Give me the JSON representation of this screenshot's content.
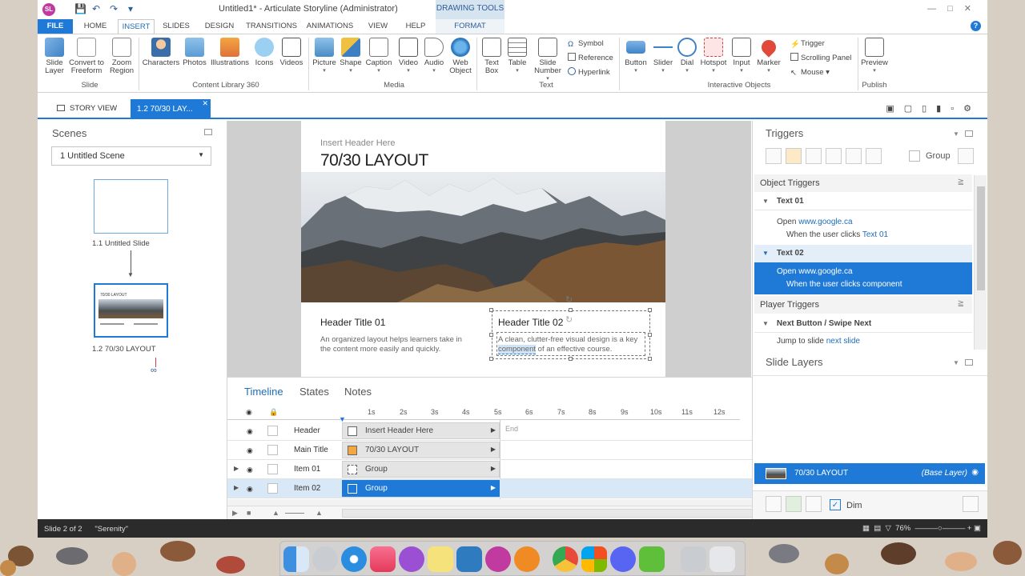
{
  "titlebar": {
    "logo": "SL",
    "title": "Untitled1* -  Articulate Storyline (Administrator)",
    "context_tab": "DRAWING TOOLS"
  },
  "tabs": [
    "FILE",
    "HOME",
    "INSERT",
    "SLIDES",
    "DESIGN",
    "TRANSITIONS",
    "ANIMATIONS",
    "VIEW",
    "HELP",
    "FORMAT"
  ],
  "ribbon": {
    "slide_group": [
      "Slide Layer",
      "Convert to Freeform",
      "Zoom Region"
    ],
    "slide_group_label": "Slide",
    "content_library": [
      "Characters",
      "Photos",
      "Illustrations",
      "Icons",
      "Videos"
    ],
    "content_library_label": "Content Library 360",
    "media": [
      "Picture",
      "Shape",
      "Caption",
      "Video",
      "Audio",
      "Web Object"
    ],
    "media_label": "Media",
    "text": [
      "Text Box",
      "Table",
      "Slide Number"
    ],
    "text_small": [
      "Symbol",
      "Reference",
      "Hyperlink"
    ],
    "text_label": "Text",
    "interactive": [
      "Button",
      "Slider",
      "Dial",
      "Hotspot",
      "Input",
      "Marker"
    ],
    "interactive_small": [
      "Trigger",
      "Scrolling Panel",
      "Mouse"
    ],
    "interactive_label": "Interactive Objects",
    "publish": "Preview",
    "publish_label": "Publish"
  },
  "docbar": {
    "story_view": "STORY VIEW",
    "slide_tab": "1.2 70/30 LAY..."
  },
  "scenes": {
    "title": "Scenes",
    "selected_scene": "1 Untitled Scene",
    "slides": [
      "1.1 Untitled Slide",
      "1.2 70/30 LAYOUT"
    ]
  },
  "slide": {
    "insert_header": "Insert Header Here",
    "main_title": "70/30 LAYOUT",
    "header_title_01": "Header Title 01",
    "text_01": "An organized layout helps learners take in the content more easily and quickly.",
    "header_title_02": "Header Title 02",
    "text_02_before": "A clean, clutter-free visual design is a key ",
    "text_02_highlight": "component",
    "text_02_after": " of an effective course."
  },
  "timeline": {
    "tabs": [
      "Timeline",
      "States",
      "Notes"
    ],
    "ticks": [
      "1s",
      "2s",
      "3s",
      "4s",
      "5s",
      "6s",
      "7s",
      "8s",
      "9s",
      "10s",
      "11s",
      "12s"
    ],
    "rows": [
      {
        "name": "Header",
        "bar": "Insert Header Here"
      },
      {
        "name": "Main Title",
        "bar": "70/30 LAYOUT"
      },
      {
        "name": "Item 01",
        "bar": "Group"
      },
      {
        "name": "Item 02",
        "bar": "Group"
      }
    ],
    "end_label": "End"
  },
  "triggers": {
    "title": "Triggers",
    "group_label": "Group",
    "object_triggers": "Object Triggers",
    "text01_head": "Text 01",
    "text01_action": "Open",
    "text01_url": "www.google.ca",
    "text01_when": "When the user clicks",
    "text01_obj": "Text 01",
    "text02_head": "Text 02",
    "text02_action": "Open",
    "text02_url": "www.google.ca",
    "text02_when": "When the user clicks component",
    "player_triggers": "Player Triggers",
    "next_head": "Next Button / Swipe Next",
    "next_action": "Jump to slide",
    "next_link": "next slide"
  },
  "layers": {
    "title": "Slide Layers",
    "base_name": "70/30 LAYOUT",
    "base_label": "(Base Layer)",
    "dim_label": "Dim"
  },
  "status": {
    "slide": "Slide 2 of 2",
    "theme": "\"Serenity\"",
    "zoom": "76%"
  }
}
